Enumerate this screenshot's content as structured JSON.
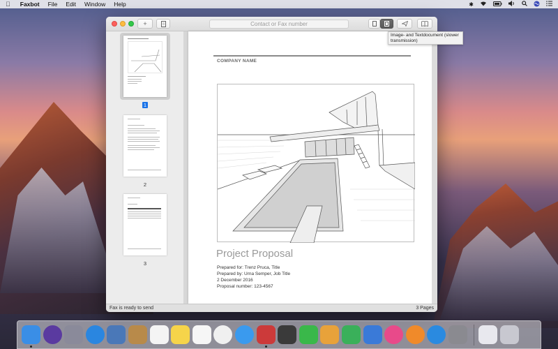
{
  "menubar": {
    "app_name": "Faxbot",
    "items": [
      "File",
      "Edit",
      "Window",
      "Help"
    ]
  },
  "window": {
    "contact_placeholder": "Contact or Fax number",
    "tooltip": "Image- and Textdocument (slower transmission)",
    "status_left": "Fax is ready to send",
    "status_right": "3 Pages"
  },
  "thumbnails": [
    {
      "label": "1",
      "selected": true
    },
    {
      "label": "2",
      "selected": false
    },
    {
      "label": "3",
      "selected": false
    }
  ],
  "document": {
    "company": "COMPANY NAME",
    "title": "Project Proposal",
    "prepared_for": "Prepared for: Trenz Pruca, Title",
    "prepared_by": "Prepared by: Urna Semper, Job Title",
    "date": "2 December 2016",
    "proposal_number": "Proposal number: 123-4567"
  },
  "dock": [
    {
      "name": "finder-icon",
      "color": "#3a8ee6"
    },
    {
      "name": "siri-icon",
      "color": "#5a3aa0"
    },
    {
      "name": "launchpad-icon",
      "color": "#8a8a9a"
    },
    {
      "name": "safari-icon",
      "color": "#2a86e0"
    },
    {
      "name": "photo-browser-icon",
      "color": "#4a78b8"
    },
    {
      "name": "contacts-icon",
      "color": "#b88a4a"
    },
    {
      "name": "calendar-icon",
      "color": "#f4f4f4"
    },
    {
      "name": "notes-icon",
      "color": "#f6d44a"
    },
    {
      "name": "reminders-icon",
      "color": "#f6f6f6"
    },
    {
      "name": "photos-icon",
      "color": "#f0f0f0"
    },
    {
      "name": "messages-icon",
      "color": "#3a9aee"
    },
    {
      "name": "faxbot-icon",
      "color": "#cc3a3a"
    },
    {
      "name": "photo-booth-icon",
      "color": "#3a3a3a"
    },
    {
      "name": "facetime-icon",
      "color": "#3ab84a"
    },
    {
      "name": "pages-icon",
      "color": "#e8a23a"
    },
    {
      "name": "numbers-icon",
      "color": "#3ab05a"
    },
    {
      "name": "keynote-icon",
      "color": "#3a7ad8"
    },
    {
      "name": "itunes-icon",
      "color": "#e84a8a"
    },
    {
      "name": "ibooks-icon",
      "color": "#f08a2a"
    },
    {
      "name": "app-store-icon",
      "color": "#2a8ae0"
    },
    {
      "name": "system-preferences-icon",
      "color": "#8a8a90"
    },
    {
      "name": "document-icon",
      "color": "#e8e8ee"
    },
    {
      "name": "trash-icon",
      "color": "#c8c8d0"
    }
  ]
}
